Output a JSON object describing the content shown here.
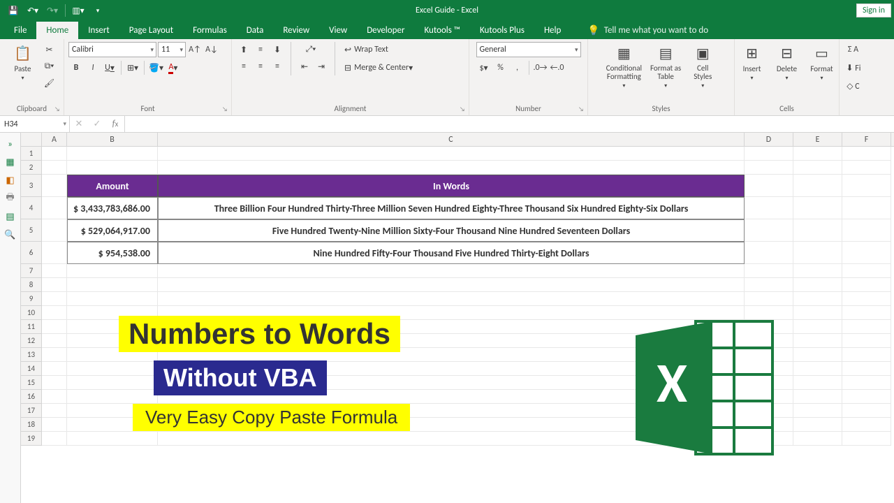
{
  "title": "Excel Guide  -  Excel",
  "signin": "Sign in",
  "qat": {
    "save": "💾",
    "undo": "↶",
    "redo": "↷"
  },
  "tabs": [
    "File",
    "Home",
    "Insert",
    "Page Layout",
    "Formulas",
    "Data",
    "Review",
    "View",
    "Developer",
    "Kutools ™",
    "Kutools Plus",
    "Help"
  ],
  "activeTab": 1,
  "tellme": "Tell me what you want to do",
  "ribbon": {
    "clipboard": {
      "paste": "Paste",
      "label": "Clipboard"
    },
    "font": {
      "name": "Calibri",
      "size": "11",
      "label": "Font",
      "bold": "B",
      "italic": "I",
      "underline": "U"
    },
    "alignment": {
      "label": "Alignment",
      "wrap": "Wrap Text",
      "merge": "Merge & Center"
    },
    "number": {
      "label": "Number",
      "format": "General"
    },
    "styles": {
      "label": "Styles",
      "cond": "Conditional\nFormatting",
      "table": "Format as\nTable",
      "cell": "Cell\nStyles"
    },
    "cells": {
      "label": "Cells",
      "insert": "Insert",
      "delete": "Delete",
      "format": "Format"
    }
  },
  "namebox": "H34",
  "cols": {
    "A": 36,
    "B": 130,
    "C": 840,
    "D": 70,
    "E": 70,
    "F": 70
  },
  "rows": {
    "headers": [
      "Amount",
      "In Words"
    ],
    "data": [
      {
        "amt": "$ 3,433,783,686.00",
        "words": "Three Billion Four Hundred Thirty-Three Million Seven Hundred Eighty-Three Thousand Six Hundred Eighty-Six Dollars"
      },
      {
        "amt": "$ 529,064,917.00",
        "words": "Five Hundred Twenty-Nine Million Sixty-Four Thousand Nine Hundred Seventeen Dollars"
      },
      {
        "amt": "$ 954,538.00",
        "words": "Nine Hundred Fifty-Four Thousand Five Hundred Thirty-Eight Dollars"
      }
    ]
  },
  "promo": {
    "l1": "Numbers to Words",
    "l2": "Without VBA",
    "l3": "Very Easy Copy Paste Formula"
  }
}
